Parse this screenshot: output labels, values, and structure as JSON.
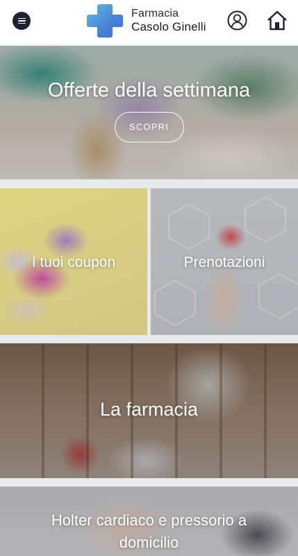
{
  "header": {
    "brand_line1": "Farmacia",
    "brand_line2": "Casolo Ginelli",
    "menu_icon": "hamburger-menu-icon",
    "logo_icon": "pharmacy-cross-logo",
    "user_icon": "user-account-icon",
    "home_icon": "home-icon",
    "logo_colors": [
      "#62c0e3",
      "#4a86d6",
      "#3d6fd0"
    ]
  },
  "tiles": {
    "hero": {
      "title": "Offerte della settimana",
      "button_label": "SCOPRI"
    },
    "coupon": {
      "title": "I tuoi coupon"
    },
    "prenotazioni": {
      "title": "Prenotazioni"
    },
    "farmacia": {
      "title": "La farmacia"
    },
    "holter": {
      "title": "Holter cardiaco e pressorio a domicilio"
    }
  }
}
